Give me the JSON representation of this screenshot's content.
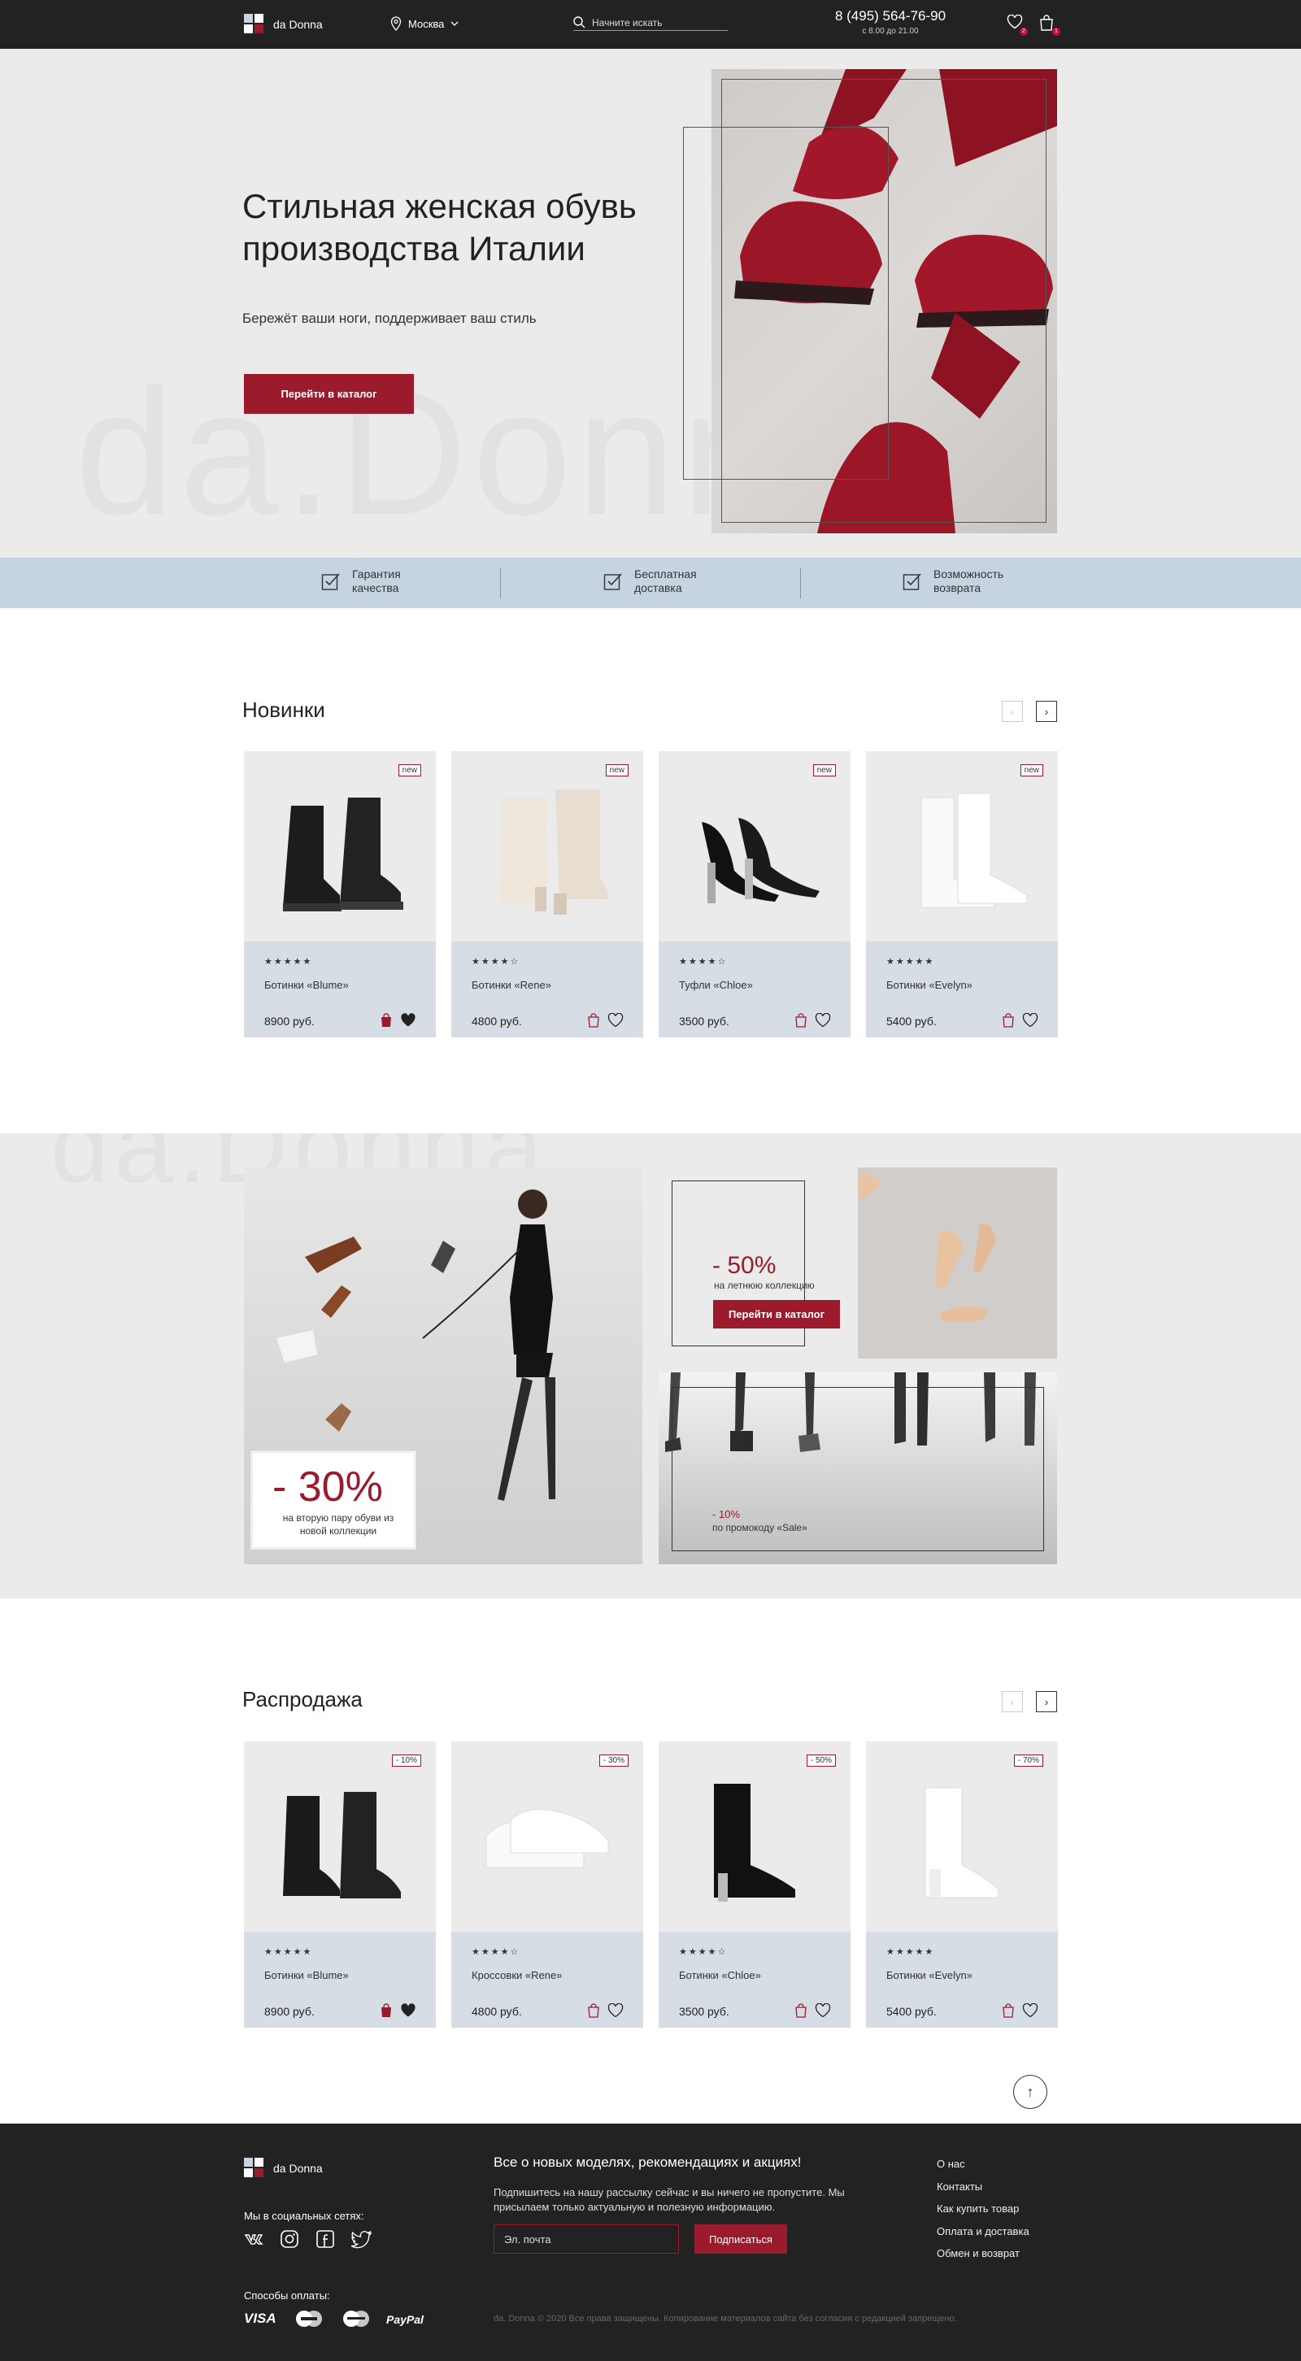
{
  "header": {
    "brand": "da Donna",
    "city": "Москва",
    "search_placeholder": "Начните искать",
    "phone": "8 (495) 564-76-90",
    "hours": "с 8.00 до 21.00",
    "fav_count": "2",
    "cart_count": "1"
  },
  "hero": {
    "title": "Стильная женская обувь производства Италии",
    "subtitle": "Бережёт ваши ноги, поддерживает ваш стиль",
    "cta": "Перейти в каталог",
    "watermark": "da.Donna"
  },
  "benefits": [
    {
      "label": "Гарантия качества"
    },
    {
      "label": "Бесплатная доставка"
    },
    {
      "label": "Возможность возврата"
    }
  ],
  "new_section": {
    "title": "Новинки",
    "products": [
      {
        "tag": "new",
        "stars": "★★★★★",
        "name": "Ботинки «Blume»",
        "price": "8900 руб."
      },
      {
        "tag": "new",
        "stars": "★★★★☆",
        "name": "Ботинки «Rene»",
        "price": "4800 руб."
      },
      {
        "tag": "new",
        "stars": "★★★★☆",
        "name": "Туфли «Chloe»",
        "price": "3500 руб."
      },
      {
        "tag": "new",
        "stars": "★★★★★",
        "name": "Ботинки «Evelyn»",
        "price": "5400 руб."
      }
    ]
  },
  "promo": {
    "watermark": "da.Donna",
    "big": {
      "percent": "- 30%",
      "text": "на вторую пару обуви из новой коллекции"
    },
    "summer": {
      "percent": "- 50%",
      "text": "на летнюю коллекцию",
      "cta": "Перейти в каталог"
    },
    "code": {
      "percent": "- 10%",
      "text": "по промокоду «Sale»"
    }
  },
  "sale_section": {
    "title": "Распродажа",
    "products": [
      {
        "tag": "- 10%",
        "stars": "★★★★★",
        "name": "Ботинки «Blume»",
        "price": "8900 руб."
      },
      {
        "tag": "- 30%",
        "stars": "★★★★☆",
        "name": "Кроссовки «Rene»",
        "price": "4800 руб."
      },
      {
        "tag": "- 50%",
        "stars": "★★★★☆",
        "name": "Ботинки «Chloe»",
        "price": "3500 руб."
      },
      {
        "tag": "- 70%",
        "stars": "★★★★★",
        "name": "Ботинки «Evelyn»",
        "price": "5400 руб."
      }
    ]
  },
  "footer": {
    "brand": "da Donna",
    "social_title": "Мы в социальных сетях:",
    "pay_title": "Способы оплаты:",
    "pay_methods": [
      "VISA",
      "PayPal"
    ],
    "newsletter_title": "Все о новых моделях, рекомендациях и акциях!",
    "newsletter_text": "Подпишитесь на нашу рассылку сейчас и вы ничего не пропустите. Мы присылаем только актуальную и полезную информацию.",
    "email_placeholder": "Эл. почта",
    "subscribe": "Подписаться",
    "menu": [
      "О нас",
      "Контакты",
      "Как купить товар",
      "Оплата и доставка",
      "Обмен и возврат"
    ],
    "copyright": "da. Donna © 2020 Все права защищены. Копирование материалов сайта без согласия с редакцией запрещено."
  },
  "colors": {
    "accent": "#9b1b2d",
    "dark": "#232222",
    "light_bg": "#ebebeb",
    "blue_band": "#c6d3e1",
    "card_bottom": "#d7dde5"
  }
}
